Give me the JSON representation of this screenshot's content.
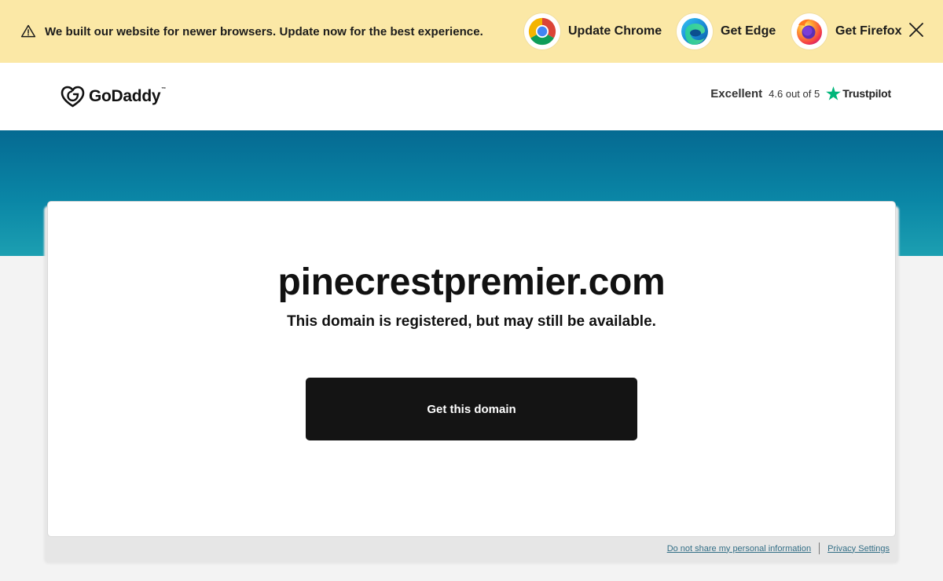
{
  "banner": {
    "message": "We built our website for newer browsers. Update now for the best experience.",
    "warning_icon": "warning-triangle-icon",
    "browsers": [
      {
        "label": "Update Chrome",
        "icon": "chrome-logo-icon"
      },
      {
        "label": "Get Edge",
        "icon": "edge-logo-icon"
      },
      {
        "label": "Get Firefox",
        "icon": "firefox-logo-icon"
      }
    ],
    "close_icon": "close-icon",
    "background": "#fbe8a6"
  },
  "header": {
    "logo_text": "GoDaddy",
    "logo_tm": "™",
    "trustpilot": {
      "rating_word": "Excellent",
      "score": "4.6 out of 5",
      "brand": "Trustpilot",
      "star_color": "#00b67a"
    }
  },
  "main": {
    "domain": "pinecrestpremier.com",
    "subtitle": "This domain is registered, but may still be available.",
    "cta_label": "Get this domain"
  },
  "footer": {
    "do_not_share": "Do not share my personal information",
    "privacy_settings": "Privacy Settings"
  },
  "colors": {
    "hero_top": "#056a92",
    "hero_bottom": "#1c9fb1",
    "cta_bg": "#141414",
    "link": "#336e86"
  }
}
